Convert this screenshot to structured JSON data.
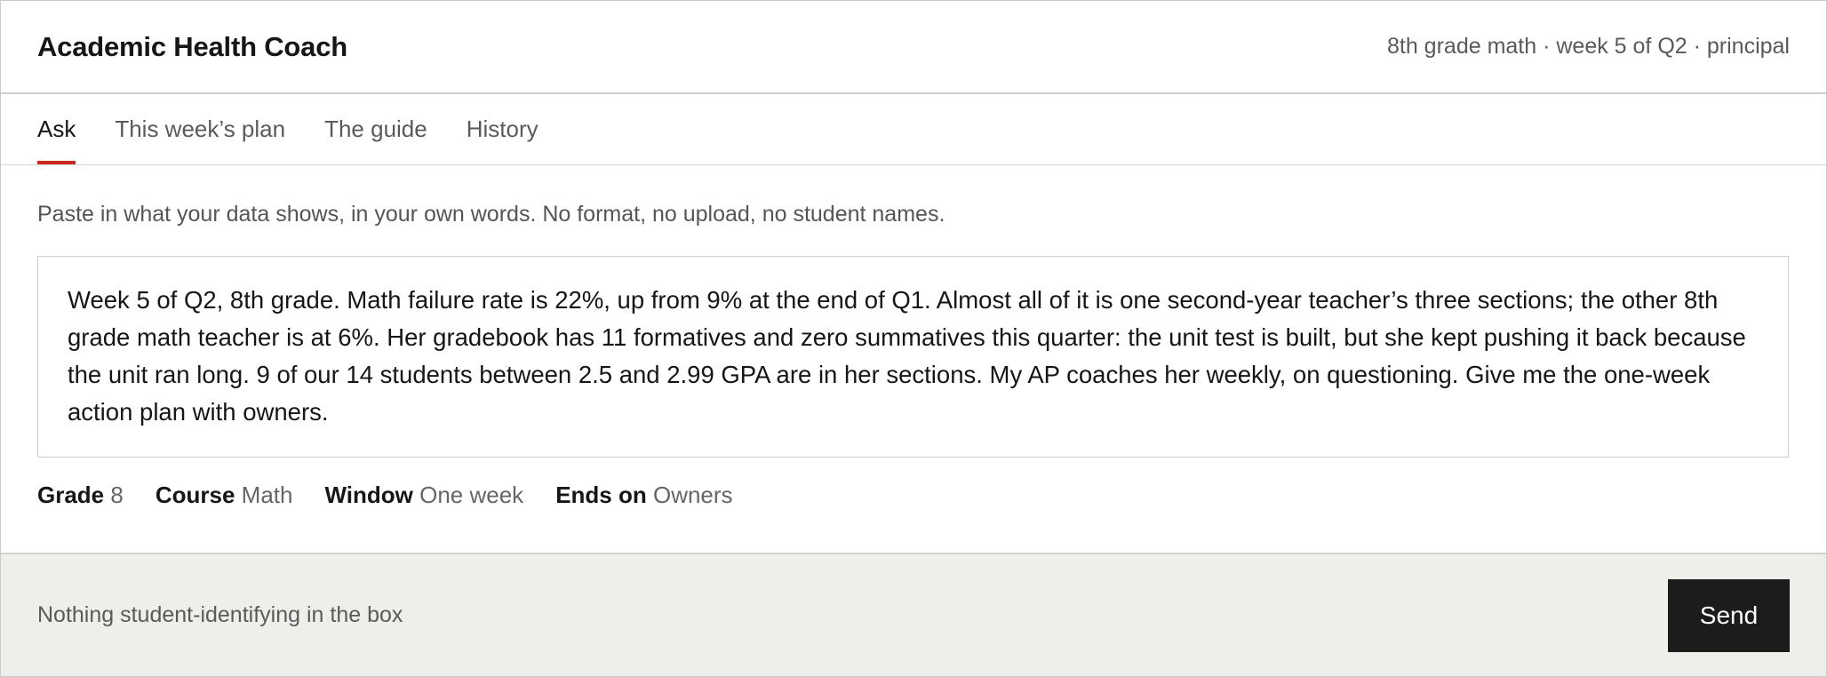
{
  "header": {
    "title": "Academic Health Coach",
    "context": "8th grade math · week 5 of Q2 · principal"
  },
  "tabs": [
    {
      "label": "Ask",
      "active": true
    },
    {
      "label": "This week’s plan",
      "active": false
    },
    {
      "label": "The guide",
      "active": false
    },
    {
      "label": "History",
      "active": false
    }
  ],
  "main": {
    "instruction": "Paste in what your data shows, in your own words. No format, no upload, no student names.",
    "input_value": "Week 5 of Q2, 8th grade. Math failure rate is 22%, up from 9% at the end of Q1. Almost all of it is one second-year teacher’s three sections; the other 8th grade math teacher is at 6%. Her gradebook has 11 formatives and zero summatives this quarter: the unit test is built, but she kept pushing it back because the unit ran long. 9 of our 14 students between 2.5 and 2.99 GPA are in her sections. My AP coaches her weekly, on questioning. Give me the one-week action plan with owners.",
    "meta": [
      {
        "key": "Grade",
        "value": "8"
      },
      {
        "key": "Course",
        "value": "Math"
      },
      {
        "key": "Window",
        "value": "One week"
      },
      {
        "key": "Ends on",
        "value": "Owners"
      }
    ]
  },
  "footer": {
    "note": "Nothing student-identifying in the box",
    "send_label": "Send"
  },
  "colors": {
    "accent_tab_underline": "#c8281e",
    "send_button_bg": "#1c1c1c",
    "footer_bg": "#eeeeea"
  }
}
